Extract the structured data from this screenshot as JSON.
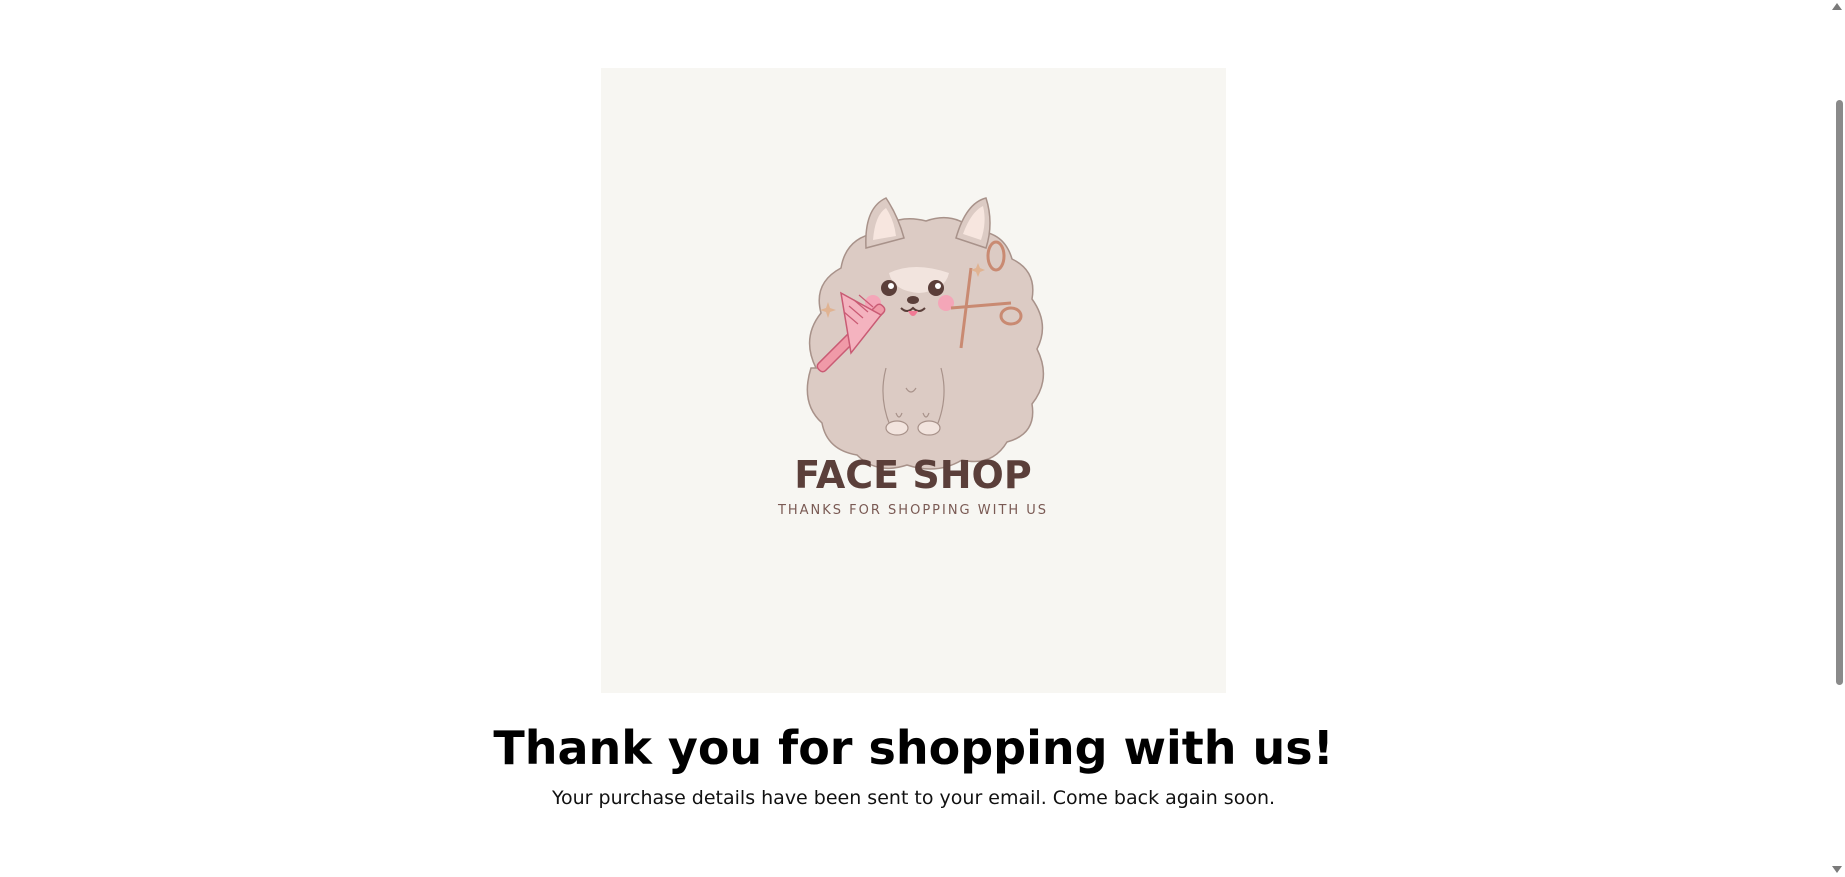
{
  "hero": {
    "brand_name": "FACE SHOP",
    "tagline": "THANKS FOR SHOPPING WITH US",
    "image_subject": "fluffy-dog-with-comb-and-scissors",
    "colors": {
      "background": "#f7f6f2",
      "fur": "#dccbc4",
      "brand_text": "#5b3f3a",
      "comb": "#f09aa8",
      "scissors": "#d9a08a"
    }
  },
  "confirmation": {
    "heading": "Thank you for shopping with us!",
    "message": "Your purchase details have been sent to your email. Come back again soon."
  }
}
